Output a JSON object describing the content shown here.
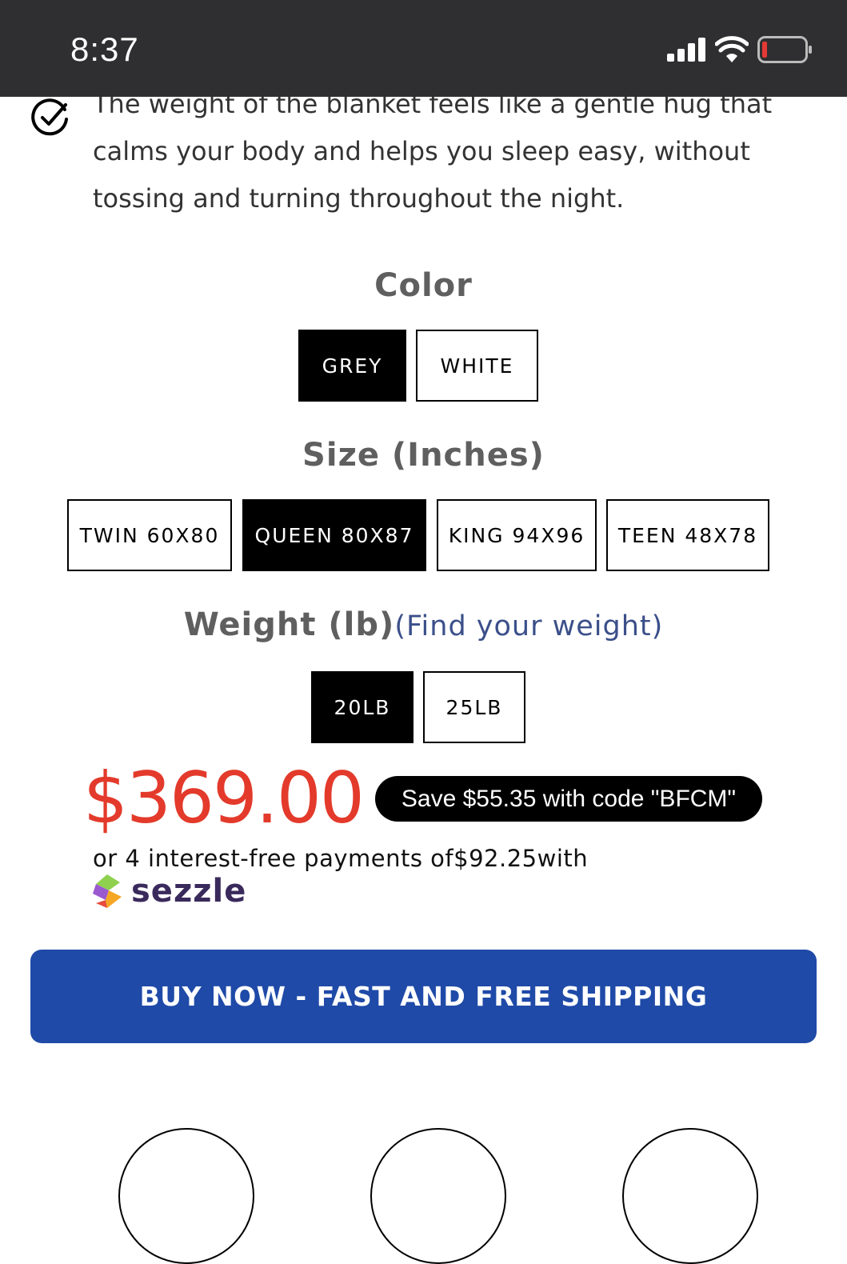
{
  "status_bar": {
    "time": "8:37",
    "icons": [
      "cellular-signal-icon",
      "wifi-icon",
      "battery-low-icon"
    ]
  },
  "feature": {
    "icon": "check-circle-icon",
    "text": "The weight of the blanket feels like a gentle hug that calms your body and helps you sleep easy, without tossing and turning throughout the night."
  },
  "color": {
    "title": "Color",
    "options": [
      {
        "label": "GREY",
        "selected": true
      },
      {
        "label": "WHITE",
        "selected": false
      }
    ]
  },
  "size": {
    "title": "Size (Inches)",
    "options": [
      {
        "label": "TWIN 60X80",
        "selected": false
      },
      {
        "label": "QUEEN 80X87",
        "selected": true
      },
      {
        "label": "KING 94X96",
        "selected": false
      },
      {
        "label": "TEEN 48X78",
        "selected": false
      }
    ]
  },
  "weight": {
    "title": "Weight (lb)",
    "link": "(Find your weight)",
    "options": [
      {
        "label": "20LB",
        "selected": true
      },
      {
        "label": "25LB",
        "selected": false
      }
    ]
  },
  "pricing": {
    "price": "$369.00",
    "promo": "Save $55.35 with code \"BFCM\"",
    "installments_text": "or 4 interest-free payments of$92.25with",
    "provider": "sezzle",
    "price_color": "#e33a2b"
  },
  "cta": {
    "label": "BUY NOW - FAST AND FREE SHIPPING",
    "color": "#1f4aa8"
  }
}
